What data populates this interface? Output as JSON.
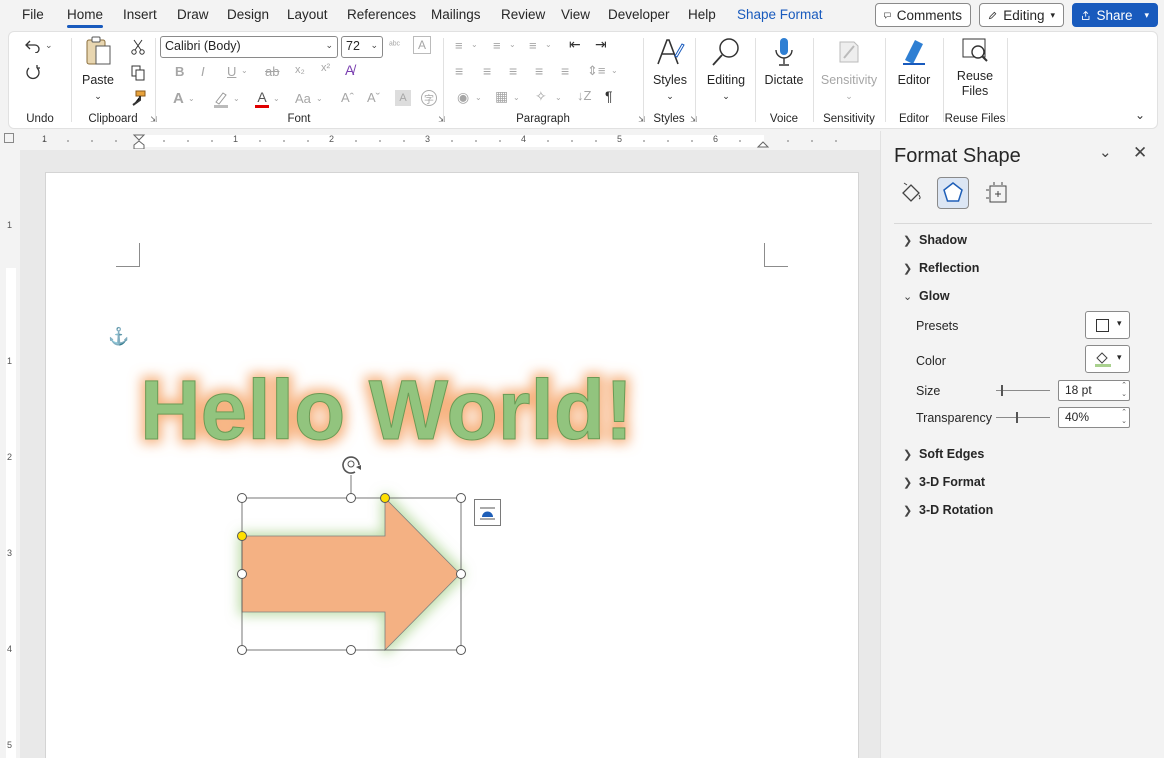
{
  "menu": {
    "tabs": [
      "File",
      "Home",
      "Insert",
      "Draw",
      "Design",
      "Layout",
      "References",
      "Mailings",
      "Review",
      "View",
      "Developer",
      "Help",
      "Shape Format"
    ],
    "active_tab": "Home",
    "comments_label": "Comments",
    "editing_label": "Editing",
    "share_label": "Share"
  },
  "ribbon": {
    "groups": {
      "undo": "Undo",
      "clipboard": "Clipboard",
      "font": "Font",
      "paragraph": "Paragraph",
      "styles": "Styles",
      "voice": "Voice",
      "sensitivity": "Sensitivity",
      "editor": "Editor",
      "reuse_files": "Reuse Files"
    },
    "paste_label": "Paste",
    "font_name": "Calibri (Body)",
    "font_size": "72",
    "styles_label": "Styles",
    "editing_label": "Editing",
    "dictate_label": "Dictate",
    "sensitivity_label": "Sensitivity",
    "editor_label": "Editor",
    "reuse_files_label": "Reuse Files"
  },
  "ruler": {
    "h_numbers": [
      "1",
      "1",
      "2",
      "3",
      "4",
      "5",
      "6"
    ],
    "v_numbers": [
      "1",
      "1",
      "2",
      "3",
      "4",
      "5"
    ]
  },
  "document": {
    "wordart_text": "Hello World!",
    "colors": {
      "text_fill": "#92c47e",
      "text_glow": "#f5a66b",
      "arrow_fill": "#f4b183",
      "arrow_glow": "#a9d18e",
      "handle_yellow": "#ffe000"
    }
  },
  "pane": {
    "title": "Format Shape",
    "sections": {
      "shadow": "Shadow",
      "reflection": "Reflection",
      "glow": "Glow",
      "soft_edges": "Soft Edges",
      "format_3d": "3-D Format",
      "rotation_3d": "3-D Rotation"
    },
    "glow": {
      "presets_label": "Presets",
      "color_label": "Color",
      "size_label": "Size",
      "size_value": "18 pt",
      "transparency_label": "Transparency",
      "transparency_value": "40%",
      "color_value": "#a9d18e"
    }
  }
}
